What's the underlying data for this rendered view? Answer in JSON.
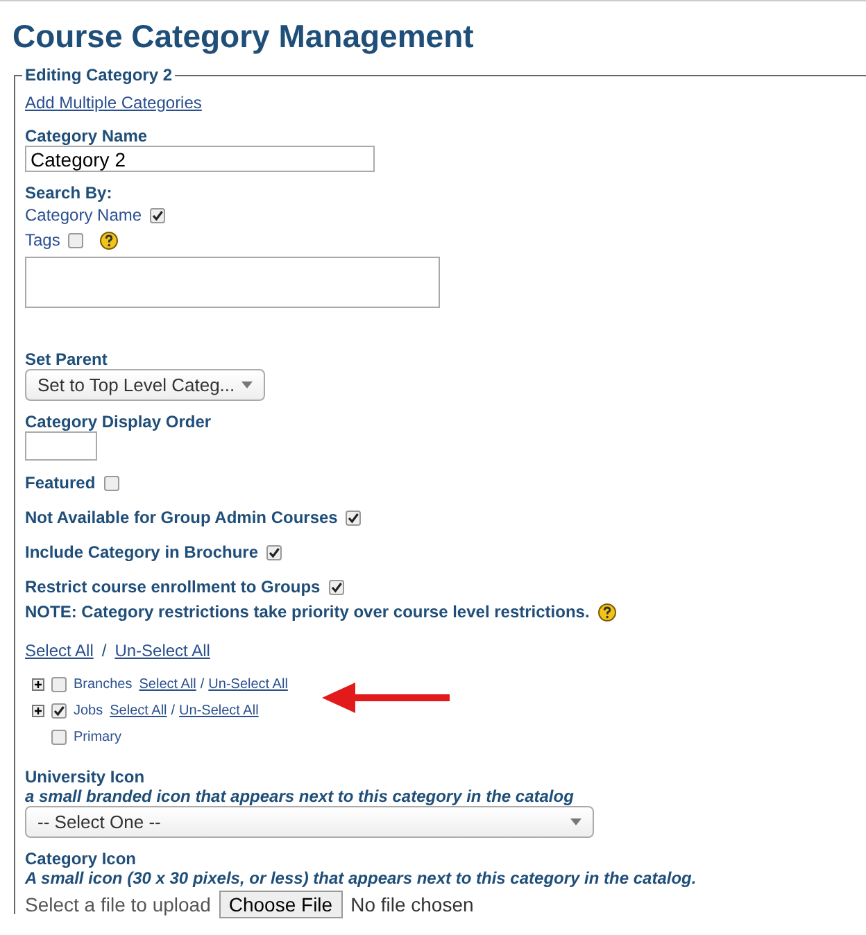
{
  "title": "Course Category Management",
  "legend": "Editing Category 2",
  "items": [
    {
      "kind": "link",
      "text": "Add Multiple Categories"
    },
    {
      "kind": "label",
      "text": "Category Name"
    },
    {
      "kind": "name-input",
      "value": "Category 2"
    },
    {
      "kind": "label",
      "text": "Search By:"
    },
    {
      "kind": "option",
      "text": "Category Name",
      "checked": true,
      "help": false
    },
    {
      "kind": "option",
      "text": "Tags",
      "checked": false,
      "help": true
    },
    {
      "kind": "textarea"
    },
    {
      "kind": "label",
      "text": "Set Parent"
    },
    {
      "kind": "parent-select",
      "value": "Set to Top Level Categ..."
    },
    {
      "kind": "label",
      "text": "Category Display Order"
    },
    {
      "kind": "order-input"
    },
    {
      "kind": "flag",
      "text": "Featured",
      "checked": false,
      "help": false
    },
    {
      "kind": "flag",
      "text": "Not Available for Group Admin Courses",
      "checked": true,
      "help": false
    },
    {
      "kind": "flag",
      "text": "Include Category in Brochure",
      "checked": true,
      "help": false
    },
    {
      "kind": "flag",
      "text": "Restrict course enrollment to Groups",
      "checked": true,
      "help": false
    },
    {
      "kind": "note",
      "text": "NOTE: Category restrictions take priority over course level restrictions.",
      "help": true
    },
    {
      "kind": "links",
      "links": [
        "Select All",
        "Un-Select All"
      ],
      "separator": "/"
    },
    {
      "kind": "tree",
      "nodes": [
        {
          "label": "Branches",
          "expandable": true,
          "checked": false,
          "links": [
            "Select All",
            "Un-Select All"
          ],
          "separator": "/"
        },
        {
          "label": "Jobs",
          "expandable": true,
          "checked": true,
          "links": [
            "Select All",
            "Un-Select All"
          ],
          "separator": "/"
        },
        {
          "label": "Primary",
          "expandable": false,
          "checked": false
        }
      ]
    },
    {
      "kind": "label",
      "text": "University Icon"
    },
    {
      "kind": "hint",
      "text": "a small branded icon that appears next to this category in the catalog"
    },
    {
      "kind": "icon-select",
      "value": "-- Select One --"
    },
    {
      "kind": "label",
      "text": "Category Icon"
    },
    {
      "kind": "hint",
      "text": "A small icon (30 x 30 pixels, or less) that appears next to this category in the catalog."
    },
    {
      "kind": "file",
      "prompt": "Select a file to upload",
      "button": "Choose File",
      "status": "No file chosen"
    }
  ]
}
